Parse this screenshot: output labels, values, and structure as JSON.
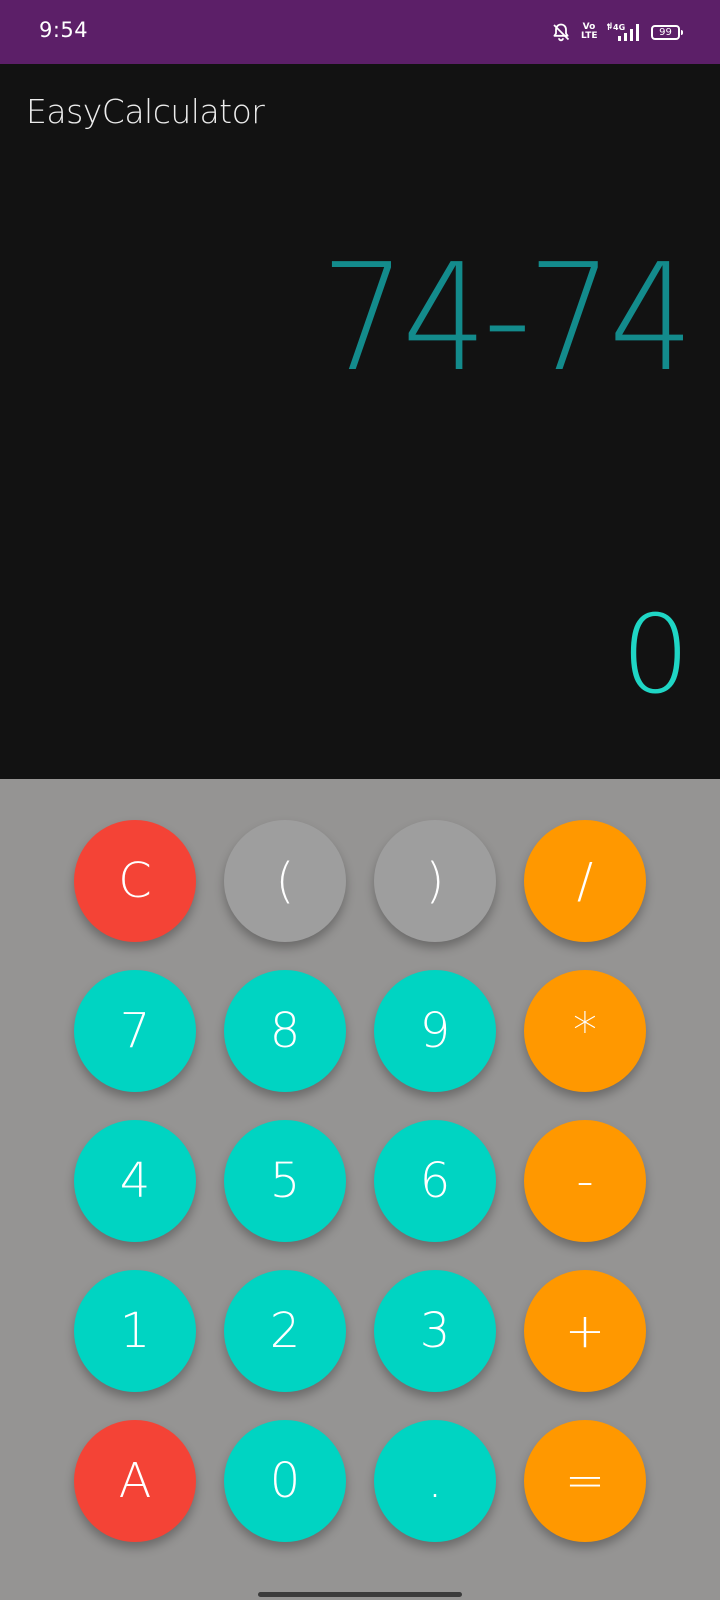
{
  "status_bar": {
    "time": "9:54",
    "battery": "99",
    "volte_top": "Vo",
    "volte_bottom": "LTE",
    "network": "4G",
    "background": "#5c1f68",
    "icons": [
      "mute-icon",
      "volte-icon",
      "signal-icon",
      "battery-icon"
    ]
  },
  "app": {
    "title": "EasyCalculator"
  },
  "display": {
    "expression": "74-74",
    "result": "0",
    "expression_color": "#138b8c",
    "result_color": "#1fd6c5"
  },
  "keypad": {
    "background": "#959493",
    "colors": {
      "red": "#f44336",
      "grey": "#9e9e9e",
      "teal": "#00d4c2",
      "orange": "#ff9800"
    },
    "keys": {
      "clear": "C",
      "open_paren": "(",
      "close_paren": ")",
      "divide": "/",
      "seven": "7",
      "eight": "8",
      "nine": "9",
      "multiply": "*",
      "four": "4",
      "five": "5",
      "six": "6",
      "minus": "-",
      "one": "1",
      "two": "2",
      "three": "3",
      "plus": "+",
      "all_clear": "A",
      "zero": "0",
      "decimal": ".",
      "equals": "="
    }
  }
}
